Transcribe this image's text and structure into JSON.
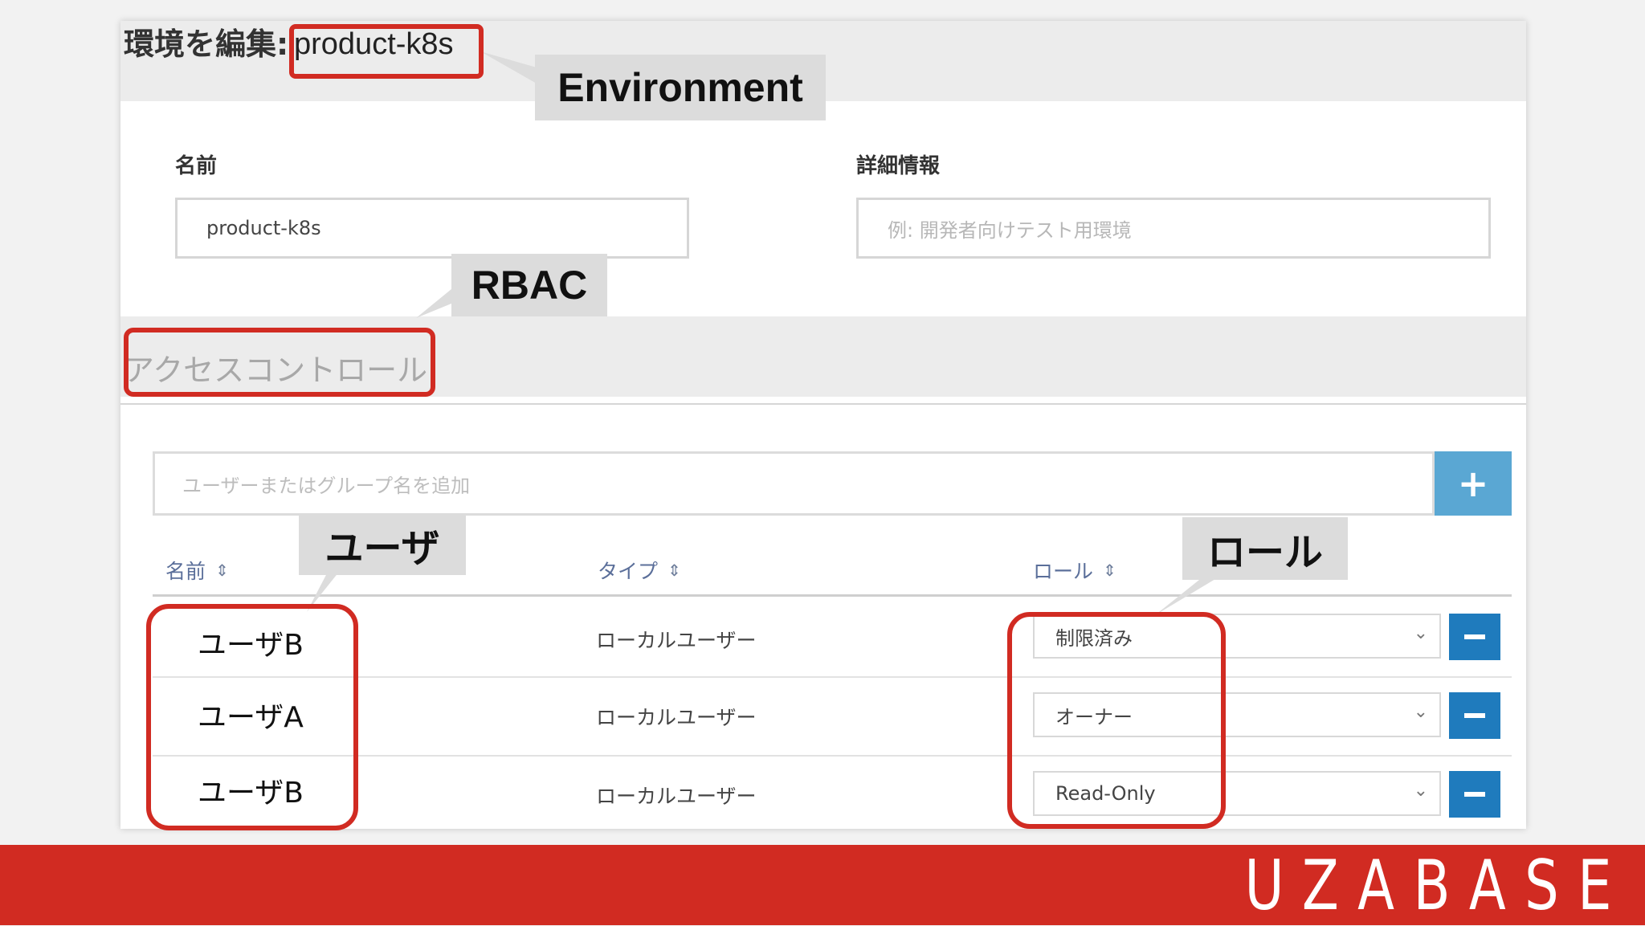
{
  "header": {
    "prefix": "環境を編集:",
    "env_name": "product-k8s"
  },
  "form": {
    "name_label": "名前",
    "name_value": "product-k8s",
    "description_label": "詳細情報",
    "description_placeholder": "例: 開発者向けテスト用環境"
  },
  "access_control": {
    "title": "アクセスコントロール",
    "add_placeholder": "ユーザーまたはグループ名を追加",
    "add_button": "+",
    "columns": {
      "name": "名前",
      "type": "タイプ",
      "role": "ロール"
    },
    "rows": [
      {
        "name": "ユーザB",
        "type": "ローカルユーザー",
        "role": "制限済み"
      },
      {
        "name": "ユーザA",
        "type": "ローカルユーザー",
        "role": "オーナー"
      },
      {
        "name": "ユーザB",
        "type": "ローカルユーザー",
        "role": "Read-Only"
      }
    ]
  },
  "callouts": {
    "environment": "Environment",
    "rbac": "RBAC",
    "user": "ユーザ",
    "role": "ロール"
  },
  "footer": {
    "logo": "UZABASE"
  },
  "colors": {
    "accent_red": "#d12b22",
    "add_button": "#5aa7d3",
    "remove_button": "#1f7bbd"
  },
  "icons": {
    "add": "plus-icon",
    "remove": "minus-icon",
    "sort": "sort-icon",
    "select": "chevron-down-icon"
  }
}
